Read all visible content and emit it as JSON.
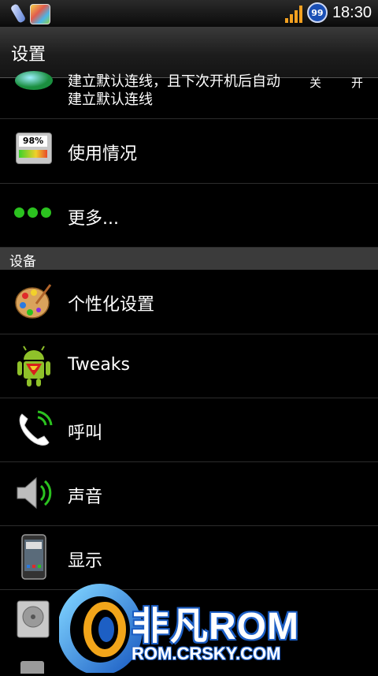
{
  "status_bar": {
    "time": "18:30",
    "badge": "99",
    "icons": [
      "usb-icon",
      "app-notification-icon",
      "signal-strength-icon",
      "badge-icon"
    ]
  },
  "title_bar": {
    "title": "设置"
  },
  "rows": {
    "mobile_network": {
      "description": "建立默认连线，且下次开机后自动建立默认连线",
      "toggle_off": "关",
      "toggle_on": "开"
    },
    "usage": {
      "label": "使用情况",
      "battery_text": "98%"
    },
    "more": {
      "label": "更多..."
    },
    "device_section": {
      "label": "设备"
    },
    "personalize": {
      "label": "个性化设置"
    },
    "tweaks": {
      "label": "Tweaks"
    },
    "call": {
      "label": "呼叫"
    },
    "sound": {
      "label": "声音"
    },
    "display": {
      "label": "显示"
    }
  },
  "watermark": {
    "brand": "非凡ROM",
    "url": "ROM.CRSKY.COM"
  },
  "colors": {
    "background": "#000000",
    "section": "#3b3b3b",
    "accent_green": "#2bc21f",
    "signal": "#f2a020"
  }
}
